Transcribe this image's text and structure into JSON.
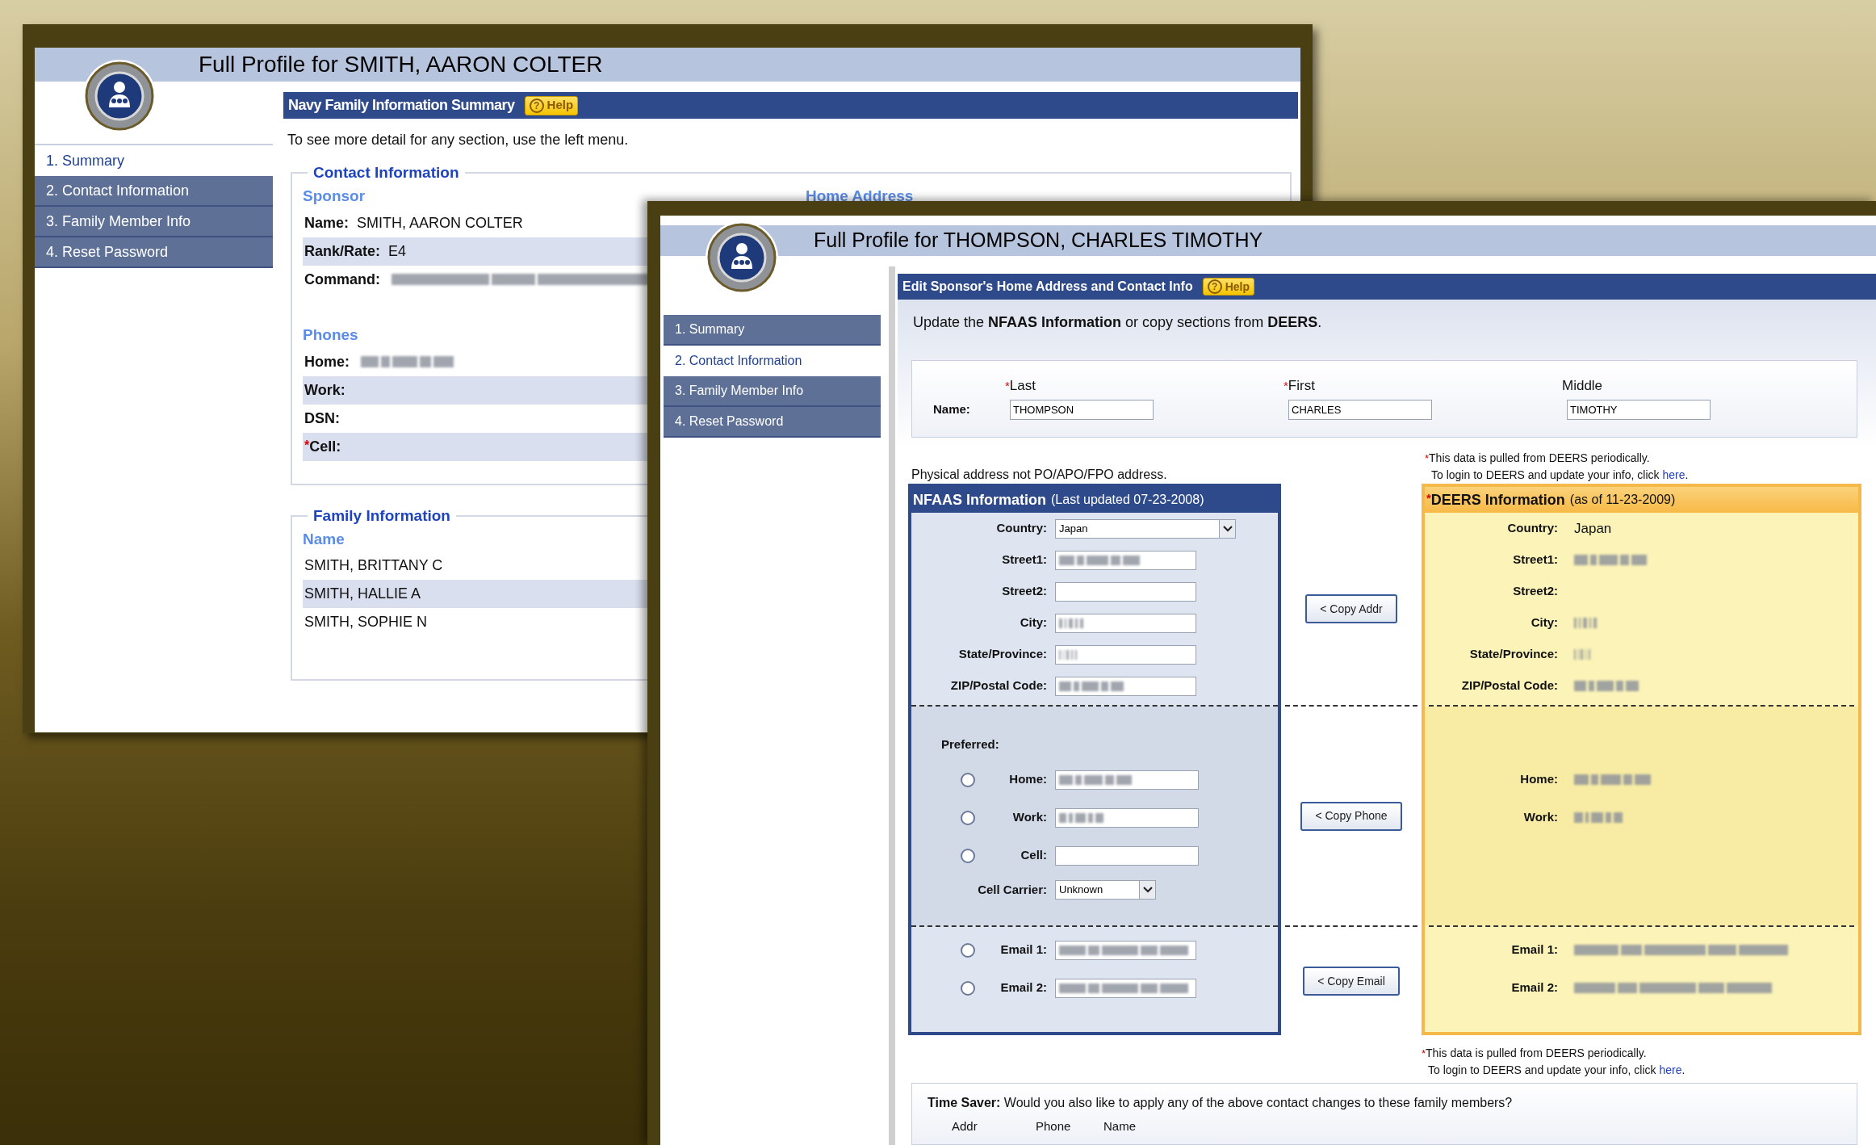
{
  "left_window": {
    "title": "Full Profile for SMITH, AARON COLTER",
    "menu": [
      {
        "label": "1. Summary",
        "selected": true
      },
      {
        "label": "2. Contact Information",
        "selected": false
      },
      {
        "label": "3. Family Member Info",
        "selected": false
      },
      {
        "label": "4. Reset Password",
        "selected": false
      }
    ],
    "section_bar": {
      "title": "Navy Family Information Summary",
      "help_icon": "?",
      "help_label": "Help"
    },
    "intro": "To see more detail for any section, use the left menu.",
    "contact": {
      "legend": "Contact Information",
      "sponsor_heading": "Sponsor",
      "home_address_heading": "Home Address",
      "sponsor_rows": [
        {
          "label": "Name:",
          "value": "SMITH, AARON COLTER",
          "blurred": false
        },
        {
          "label": "Rank/Rate:",
          "value": "E4",
          "blurred": false
        },
        {
          "label": "Command:",
          "blurred": true
        }
      ],
      "phones_heading": "Phones",
      "phone_rows": [
        {
          "label": "Home:",
          "blurred": true
        },
        {
          "label": "Work:",
          "blurred": false
        },
        {
          "label": "DSN:",
          "blurred": false
        },
        {
          "label": "Cell:",
          "required_mark": "*",
          "blurred": false
        }
      ]
    },
    "family": {
      "legend": "Family Information",
      "name_heading": "Name",
      "members": [
        "SMITH, BRITTANY C",
        "SMITH, HALLIE A",
        "SMITH, SOPHIE N"
      ]
    }
  },
  "right_window": {
    "title": "Full Profile for THOMPSON, CHARLES TIMOTHY",
    "menu": [
      {
        "label": "1. Summary",
        "selected": false
      },
      {
        "label": "2. Contact Information",
        "selected": true
      },
      {
        "label": "3. Family Member Info",
        "selected": false
      },
      {
        "label": "4. Reset Password",
        "selected": false
      }
    ],
    "section_bar": {
      "title": "Edit Sponsor's Home Address and Contact Info",
      "help_icon": "?",
      "help_label": "Help"
    },
    "intro": "Update the **NFAAS Information** or copy sections from **DEERS**.",
    "name_label": "Name:",
    "name_fields": [
      {
        "label": "Last",
        "required_mark": "*",
        "value": "THOMPSON"
      },
      {
        "label": "First",
        "required_mark": "*",
        "value": "CHARLES"
      },
      {
        "label": "Middle",
        "value": "TIMOTHY"
      }
    ],
    "address_note": "Physical address not PO/APO/FPO address.",
    "deers_note_top": {
      "mark": "*",
      "line1": "This data is pulled from DEERS periodically.",
      "line2": "To login to DEERS and update your info, click",
      "link": "here",
      "end": "."
    },
    "nfaas": {
      "title": "NFAAS Information",
      "subtitle": "(Last updated 07-23-2008)",
      "address_rows": [
        {
          "kind": "select",
          "label": "Country:",
          "value": "Japan"
        },
        {
          "kind": "input",
          "label": "Street1:",
          "blurred": true
        },
        {
          "kind": "input",
          "label": "Street2:",
          "blurred": false
        },
        {
          "kind": "input",
          "label": "City:",
          "blurred": true
        },
        {
          "kind": "input",
          "label": "State/Province:",
          "blurred": true
        },
        {
          "kind": "input",
          "label": "ZIP/Postal Code:",
          "blurred": true
        }
      ],
      "preferred_label": "Preferred:",
      "phone_rows": [
        {
          "label": "Home:",
          "selected": false,
          "blurred": true
        },
        {
          "label": "Work:",
          "selected": false,
          "blurred": true
        },
        {
          "label": "Cell:",
          "selected": false,
          "blurred": false
        }
      ],
      "carrier": {
        "label": "Cell Carrier:",
        "value": "Unknown"
      },
      "email_rows": [
        {
          "label": "Email 1:",
          "selected": false,
          "blurred": true
        },
        {
          "label": "Email 2:",
          "selected": false,
          "blurred": true
        }
      ]
    },
    "copy_buttons": [
      "< Copy Addr",
      "< Copy Phone",
      "< Copy Email"
    ],
    "deers": {
      "mark": "*",
      "title": "DEERS Information",
      "subtitle": "(as of 11-23-2009)",
      "address_rows": [
        {
          "label": "Country:",
          "value": "Japan",
          "blurred": false
        },
        {
          "label": "Street1:",
          "blurred": true
        },
        {
          "label": "Street2:",
          "blurred": false
        },
        {
          "label": "City:",
          "blurred": true
        },
        {
          "label": "State/Province:",
          "blurred": true
        },
        {
          "label": "ZIP/Postal Code:",
          "blurred": true
        }
      ],
      "phone_rows": [
        {
          "label": "Home:",
          "blurred": true
        },
        {
          "label": "Work:",
          "blurred": true
        }
      ],
      "email_rows": [
        {
          "label": "Email 1:",
          "blurred": true
        },
        {
          "label": "Email 2:",
          "blurred": true
        }
      ]
    },
    "deers_note_bottom": {
      "mark": "*",
      "line1": "This data is pulled from DEERS periodically.",
      "line2": "To login to DEERS and update your info, click",
      "link": "here",
      "end": "."
    },
    "time_saver": {
      "text": "**Time Saver:** Would you also like to apply any of the above contact changes to these family members?",
      "columns": [
        "Addr",
        "Phone",
        "Name"
      ]
    }
  }
}
